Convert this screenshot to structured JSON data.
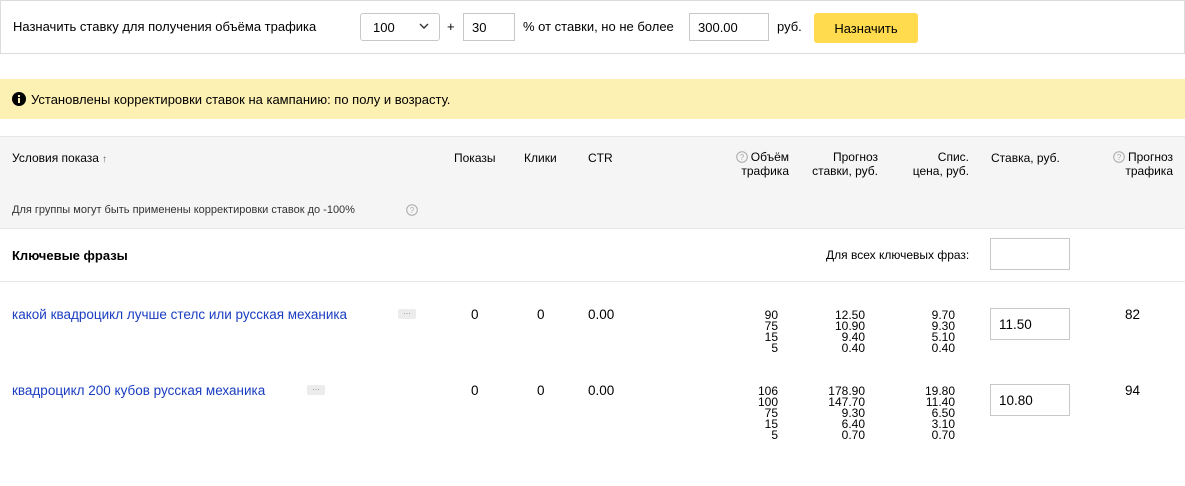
{
  "toolbar": {
    "label": "Назначить ставку для получения объёма трафика",
    "traffic_select_value": "100",
    "plus": "+",
    "percent_value": "30",
    "percent_text": "% от ставки, но не более",
    "max_value": "300.00",
    "currency": "руб.",
    "assign_button": "Назначить"
  },
  "notice": {
    "text": "Установлены корректировки ставок на кампанию: по полу и возрасту.",
    "background": "#fdf0b3"
  },
  "table": {
    "columns": {
      "conditions": "Условия показа",
      "sort_indicator": "↑",
      "impressions": "Показы",
      "clicks": "Клики",
      "ctr": "CTR",
      "traffic_volume": [
        "Объём",
        "трафика"
      ],
      "bid_forecast": [
        "Прогноз",
        "ставки, руб."
      ],
      "charge_price": [
        "Спис.",
        "цена, руб."
      ],
      "bid": "Ставка, руб.",
      "traffic_forecast": [
        "Прогноз",
        "трафика"
      ]
    },
    "group_note": "Для группы могут быть применены корректировки ставок до -100%",
    "keywords_section": {
      "title": "Ключевые фразы",
      "all_keywords_label": "Для всех ключевых фраз:",
      "all_keywords_value": ""
    },
    "rows": [
      {
        "phrase": "какой квадроцикл лучше стелс или русская механика",
        "more": "...",
        "impressions": "0",
        "clicks": "0",
        "ctr": "0.00",
        "traffic_volume": [
          "90",
          "75",
          "15",
          "5"
        ],
        "bid_forecast": [
          "12.50",
          "10.90",
          "9.40",
          "0.40"
        ],
        "charge_price": [
          "9.70",
          "9.30",
          "5.10",
          "0.40"
        ],
        "bid": "11.50",
        "traffic_forecast": "82"
      },
      {
        "phrase": "квадроцикл 200 кубов русская механика",
        "more": "...",
        "impressions": "0",
        "clicks": "0",
        "ctr": "0.00",
        "traffic_volume": [
          "106",
          "100",
          "75",
          "15",
          "5"
        ],
        "bid_forecast": [
          "178.90",
          "147.70",
          "9.30",
          "6.40",
          "0.70"
        ],
        "charge_price": [
          "19.80",
          "11.40",
          "6.50",
          "3.10",
          "0.70"
        ],
        "bid": "10.80",
        "traffic_forecast": "94"
      }
    ]
  },
  "colors": {
    "link": "#1a3dc1",
    "accent_button": "#ffdb4d",
    "header_bg": "#f5f5f5"
  },
  "icons": [
    "chevron-down-icon",
    "info-icon",
    "question-icon"
  ]
}
